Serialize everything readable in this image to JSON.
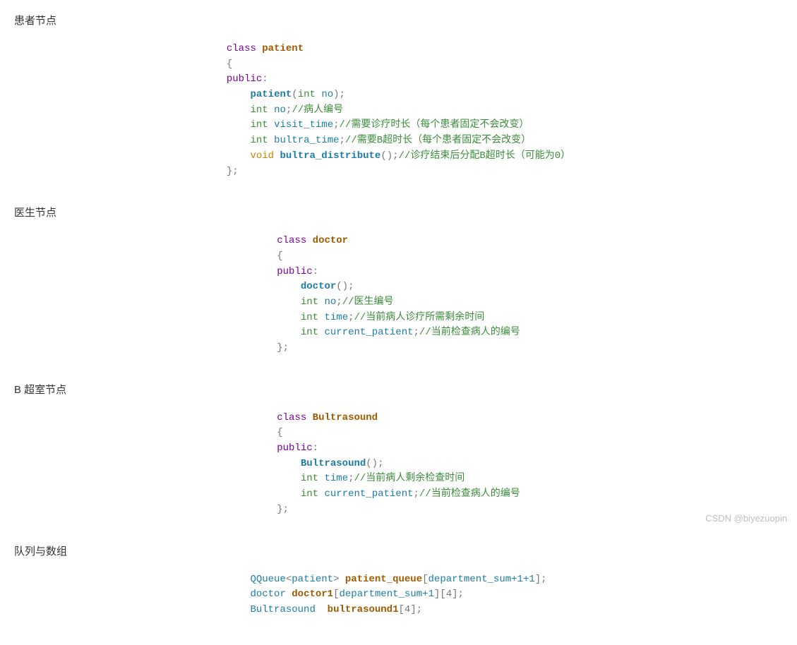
{
  "sections": {
    "patient_node": "患者节点",
    "doctor_node": "医生节点",
    "bultra_node": "B 超室节点",
    "queue_array": "队列与数组"
  },
  "code": {
    "patient": {
      "l1_kw": "class",
      "l1_name": "patient",
      "l2": "{",
      "l3_kw": "public",
      "l3_colon": ":",
      "l4_name": "patient",
      "l4_type": "int",
      "l4_arg": "no",
      "l5_type": "int",
      "l5_var": "no",
      "l5_cmt": "//病人编号",
      "l6_type": "int",
      "l6_var": "visit_time",
      "l6_cmt": "//需要诊疗时长（每个患者固定不会改变）",
      "l7_type": "int",
      "l7_var": "bultra_time",
      "l7_cmt": "//需要B超时长（每个患者固定不会改变）",
      "l8_type": "void",
      "l8_name": "bultra_distribute",
      "l8_cmt": "//诊疗结束后分配B超时长（可能为0）",
      "l9": "};"
    },
    "doctor": {
      "l1_kw": "class",
      "l1_name": "doctor",
      "l2": "{",
      "l3_kw": "public",
      "l3_colon": ":",
      "l4_name": "doctor",
      "l5_type": "int",
      "l5_var": "no",
      "l5_cmt": "//医生编号",
      "l6_type": "int",
      "l6_var": "time",
      "l6_cmt": "//当前病人诊疗所需剩余时间",
      "l7_type": "int",
      "l7_var": "current_patient",
      "l7_cmt": "//当前检查病人的编号",
      "l8": "};"
    },
    "bultra": {
      "l1_kw": "class",
      "l1_name": "Bultrasound",
      "l2": "{",
      "l3_kw": "public",
      "l3_colon": ":",
      "l4_name": "Bultrasound",
      "l5_type": "int",
      "l5_var": "time",
      "l5_cmt": "//当前病人剩余检查时间",
      "l6_type": "int",
      "l6_var": "current_patient",
      "l6_cmt": "//当前检查病人的编号",
      "l7": "};"
    },
    "queue": {
      "l1_type": "QQueue",
      "l1_tmpl": "patient",
      "l1_var": "patient_queue",
      "l1_idx": "department_sum+1+1",
      "l2_type": "doctor",
      "l2_var": "doctor1",
      "l2_idx1": "department_sum+1",
      "l2_idx2": "4",
      "l3_type": "Bultrasound",
      "l3_var": "bultrasound1",
      "l3_idx": "4"
    }
  },
  "watermark": "CSDN @biyezuopin"
}
